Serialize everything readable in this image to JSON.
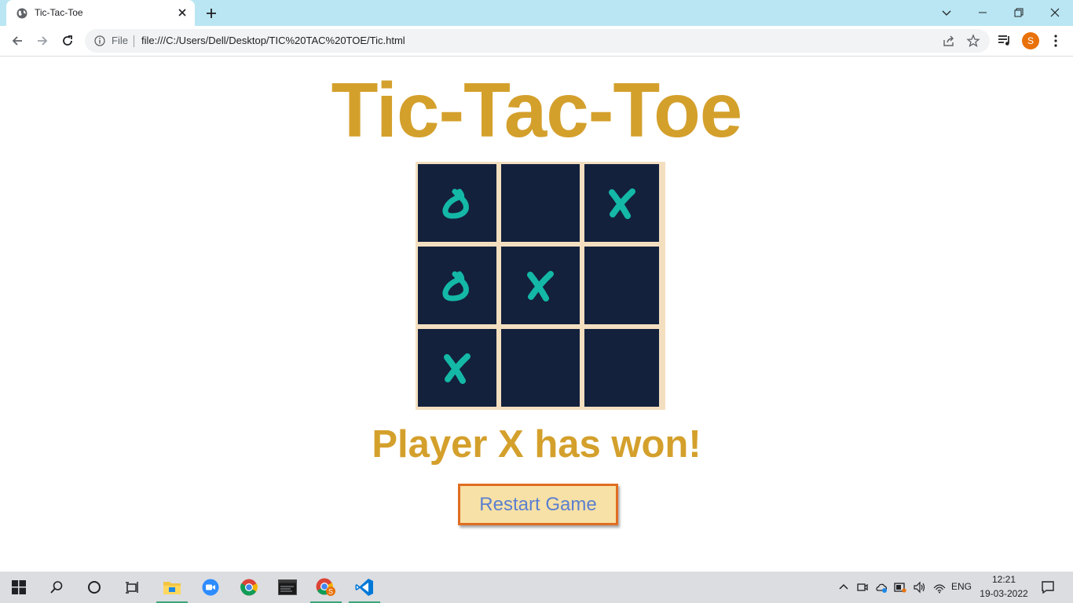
{
  "browser": {
    "tab_title": "Tic-Tac-Toe",
    "url_scheme_label": "File",
    "url": "file:///C:/Users/Dell/Desktop/TIC%20TAC%20TOE/Tic.html",
    "profile_initial": "S",
    "tabbar_color": "#b9e6f2"
  },
  "game": {
    "title": "Tic-Tac-Toe",
    "status": "Player X has won!",
    "restart_label": "Restart Game",
    "board": [
      "O",
      "",
      "X",
      "O",
      "X",
      "",
      "X",
      "",
      ""
    ],
    "colors": {
      "title": "#d4a02c",
      "cell_bg": "#13213d",
      "mark": "#14b8a6",
      "board_border": "#f3dfc0",
      "button_bg": "#f8e1a6",
      "button_border": "#e06d22",
      "button_text": "#5b7fd0"
    }
  },
  "taskbar": {
    "apps": [
      "windows-start",
      "search",
      "cortana",
      "task-view",
      "file-explorer",
      "zoom",
      "chrome",
      "terminal",
      "chrome-profile",
      "vscode"
    ],
    "lang": "ENG",
    "time": "12:21",
    "date": "19-03-2022"
  }
}
